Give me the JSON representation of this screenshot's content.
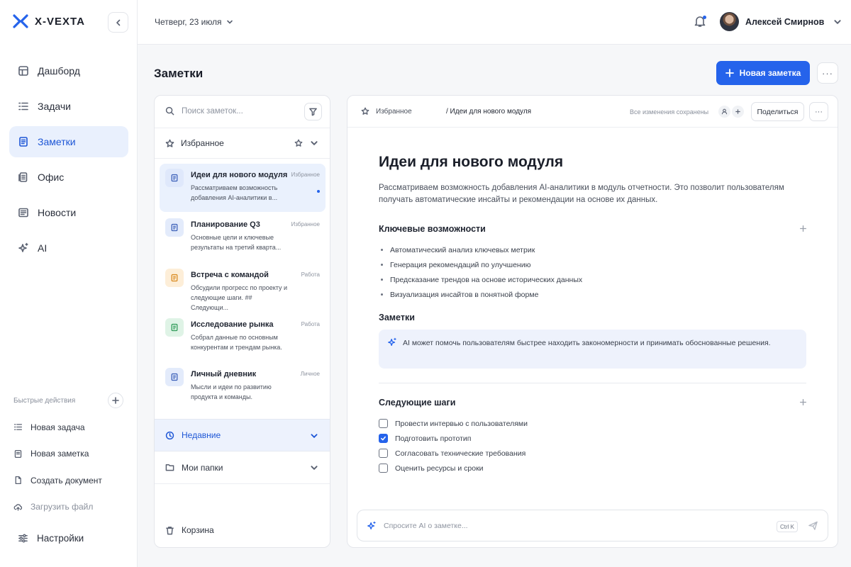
{
  "brand": {
    "name": "X-VEXTA",
    "accent": "#2563eb"
  },
  "sidebar": {
    "items": [
      {
        "label": "Дашборд",
        "icon": "dashboard-icon"
      },
      {
        "label": "Задачи",
        "icon": "tasks-icon"
      },
      {
        "label": "Заметки",
        "icon": "notes-icon",
        "active": true
      },
      {
        "label": "Офис",
        "icon": "office-icon"
      },
      {
        "label": "Новости",
        "icon": "news-icon"
      },
      {
        "label": "AI",
        "icon": "sparkle-icon"
      }
    ],
    "quick_actions_title": "Быстрые действия",
    "quick_actions": [
      {
        "label": "Новая задача",
        "icon": "task-list-icon"
      },
      {
        "label": "Новая заметка",
        "icon": "note-icon"
      },
      {
        "label": "Создать документ",
        "icon": "document-icon"
      },
      {
        "label": "Загрузить файл",
        "icon": "upload-icon"
      }
    ],
    "settings_label": "Настройки"
  },
  "topbar": {
    "date": "Четверг, 23 июля",
    "user_name": "Алексей Смирнов"
  },
  "page": {
    "title": "Заметки",
    "new_note_label": "Новая заметка"
  },
  "list": {
    "search_placeholder": "Поиск заметок...",
    "favorites_label": "Избранное",
    "notes": [
      {
        "title": "Идеи для нового модуля",
        "tag": "Избранное",
        "snippet": "Рассматриваем возможность добавления AI-аналитики в...",
        "color": "#e3ebfb",
        "icon_color": "#3b5fb8",
        "active": true
      },
      {
        "title": "Планирование Q3",
        "tag": "Избранное",
        "snippet": "Основные цели и ключевые результаты на третий кварта...",
        "color": "#e3ebfb",
        "icon_color": "#3b5fb8"
      },
      {
        "title": "Встреча с командой",
        "tag": "Работа",
        "snippet": "Обсудили прогресс по проекту и следующие шаги. ## Следующи...",
        "color": "#fdeed8",
        "icon_color": "#d98a1f"
      },
      {
        "title": "Исследование рынка",
        "tag": "Работа",
        "snippet": "Собрал данные по основным конкурентам и трендам рынка.",
        "color": "#dff3e6",
        "icon_color": "#2f9a58"
      },
      {
        "title": "Личный дневник",
        "tag": "Личное",
        "snippet": "Мысли и идеи по развитию продукта и команды.",
        "color": "#e3ebfb",
        "icon_color": "#3b5fb8"
      }
    ],
    "recent_label": "Недавние",
    "folders_label": "Мои папки",
    "trash_label": "Корзина"
  },
  "editor": {
    "crumb_root": "Избранное",
    "crumb_current": "/ Идеи для нового модуля",
    "saved_status": "Все изменения сохранены",
    "share_label": "Поделиться",
    "title": "Идеи для нового модуля",
    "intro": "Рассматриваем возможность добавления AI-аналитики в модуль отчетности. Это позволит пользователям получать автоматические инсайты и рекомендации на основе их данных.",
    "features_heading": "Ключевые возможности",
    "features": [
      "Автоматический анализ ключевых метрик",
      "Генерация рекомендаций по улучшению",
      "Предсказание трендов на основе исторических данных",
      "Визуализация инсайтов в понятной форме"
    ],
    "notes_heading": "Заметки",
    "ai_callout": "AI может помочь пользователям быстрее находить закономерности и принимать обоснованные решения.",
    "next_heading": "Следующие шаги",
    "tasks": [
      {
        "label": "Провести интервью с пользователями",
        "done": false
      },
      {
        "label": "Подготовить прототип",
        "done": true
      },
      {
        "label": "Согласовать технические требования",
        "done": false
      },
      {
        "label": "Оценить ресурсы и сроки",
        "done": false
      }
    ],
    "ask_placeholder": "Спросите AI о заметке...",
    "ask_shortcut": "Ctrl K"
  }
}
